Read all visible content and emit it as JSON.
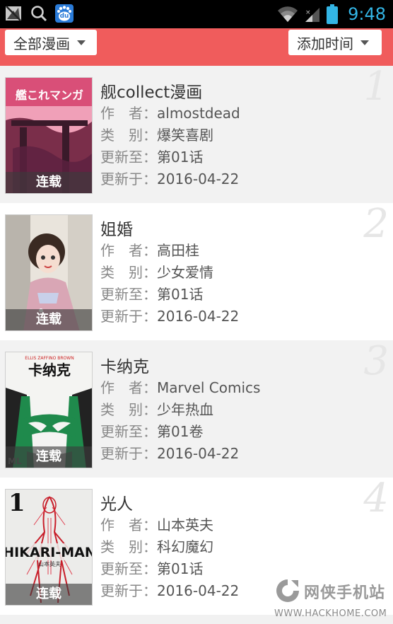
{
  "statusbar": {
    "time": "9:48",
    "icons": [
      "sim-missing-icon",
      "search-icon",
      "baidu-icon",
      "wifi-icon",
      "signal-icon",
      "battery-icon"
    ],
    "baidu_text": "du",
    "accent_color": "#33b5e5"
  },
  "filters": {
    "category": "全部漫画",
    "sort": "添加时间",
    "bar_color": "#f05c5c"
  },
  "labels": {
    "author": "作　者：",
    "genre": "类　别：",
    "update_to": "更新至：",
    "updated_on": "更新于："
  },
  "comics": [
    {
      "num": "1",
      "title": "舰collect漫画",
      "author": "almostdead",
      "genre": "爆笑喜剧",
      "update_to": "第01话",
      "updated_on": "2016-04-22",
      "status": "连载",
      "cover_text": "艦これマンガ"
    },
    {
      "num": "2",
      "title": "姐婚",
      "author": "高田桂",
      "genre": "少女爱情",
      "update_to": "第01话",
      "updated_on": "2016-04-22",
      "status": "连载"
    },
    {
      "num": "3",
      "title": "卡纳克",
      "author": "Marvel Comics",
      "genre": "少年热血",
      "update_to": "第01卷",
      "updated_on": "2016-04-22",
      "status": "连载",
      "cover_text": "卡纳克",
      "cover_credits": "ELLIS   ZAFFINO   BROWN",
      "cover_corner": "ML"
    },
    {
      "num": "4",
      "title": "光人",
      "author": "山本英夫",
      "genre": "科幻魔幻",
      "update_to": "第01话",
      "updated_on": "2016-04-22",
      "status": "连载",
      "cover_text": "HIKARI-MAN",
      "cover_volume": "1",
      "cover_author": "山本英夫"
    }
  ],
  "watermark": {
    "name": "网侠手机站",
    "url": "WWW.HACKHOME.COM"
  }
}
